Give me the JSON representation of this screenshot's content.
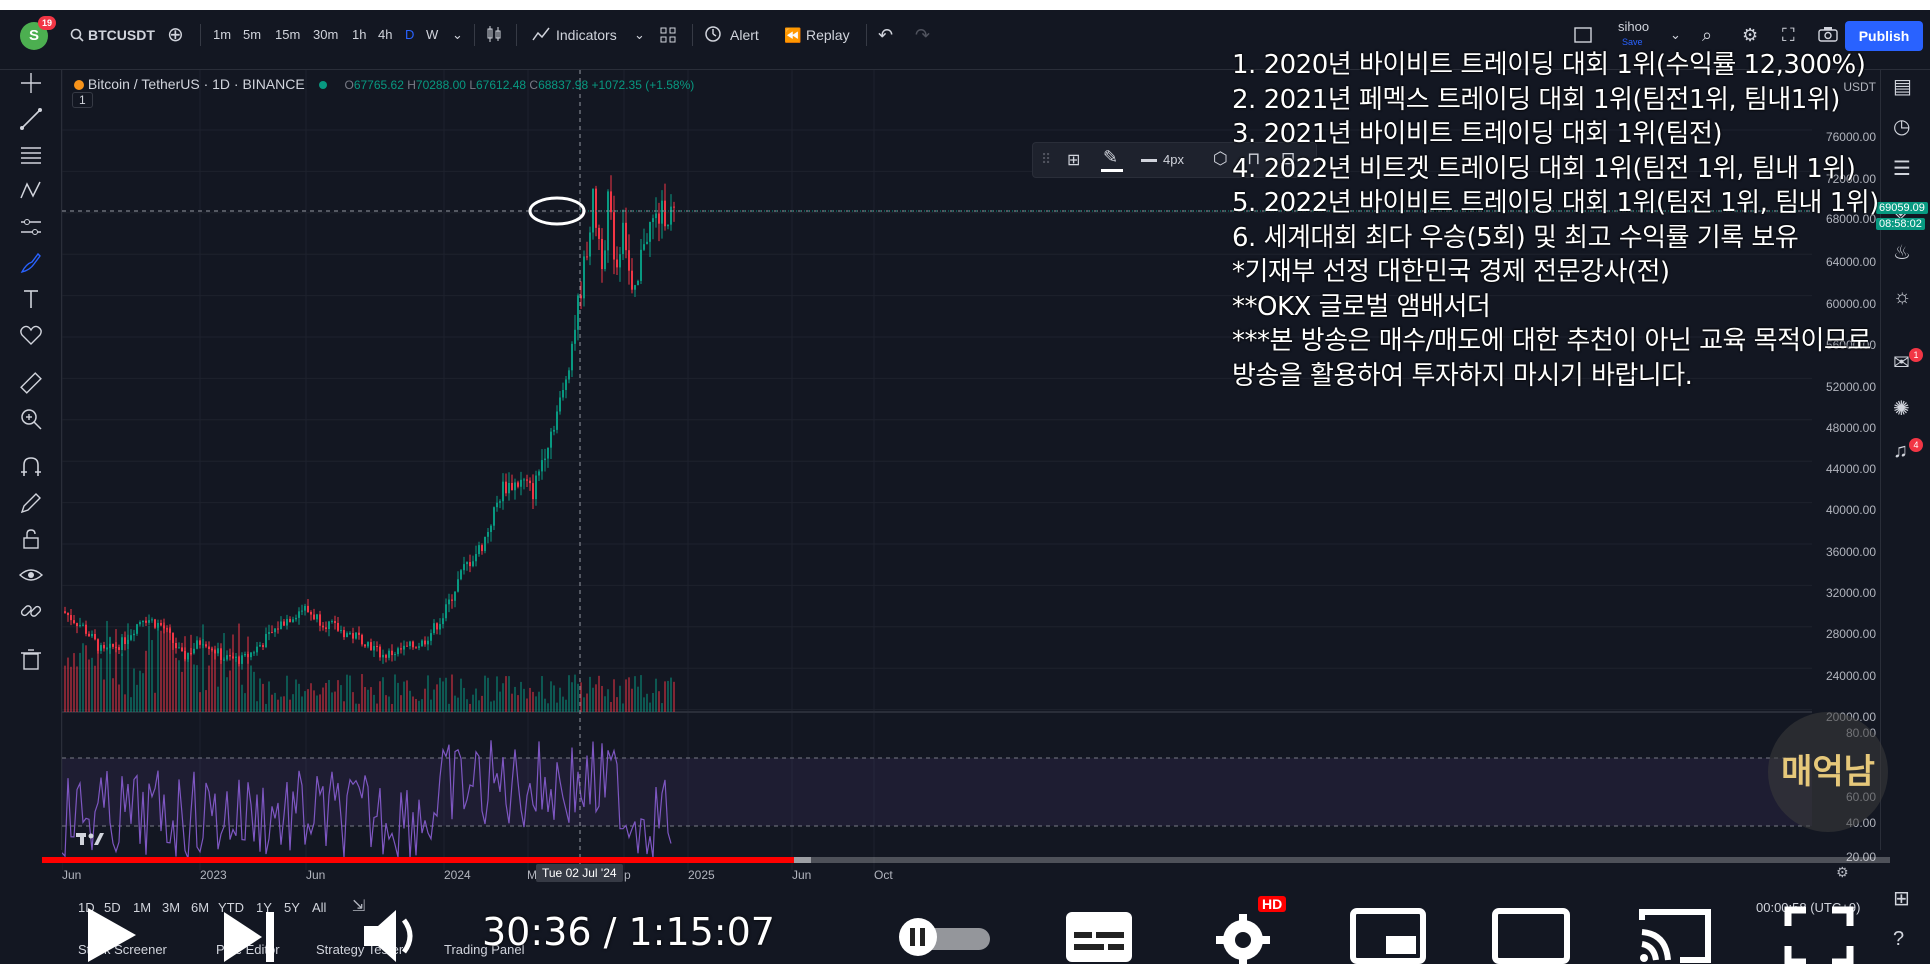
{
  "header": {
    "avatar_letter": "S",
    "avatar_badge": "19",
    "symbol": "BTCUSDT",
    "intervals": [
      "1m",
      "5m",
      "15m",
      "30m",
      "1h",
      "4h",
      "D",
      "W"
    ],
    "active_interval": "D",
    "indicators_label": "Indicators",
    "alert_label": "Alert",
    "replay_label": "Replay",
    "user": "sihoo",
    "user_status": "Save",
    "publish_label": "Publish"
  },
  "legend": {
    "name": "Bitcoin / TetherUS · 1D · BINANCE",
    "open_label": "O",
    "open": "67765.62",
    "high_label": "H",
    "high": "70288.00",
    "low_label": "L",
    "low": "67612.48",
    "close_label": "C",
    "close": "68837.98",
    "change": "+1072.35 (+1.58%)",
    "pane_number": "1"
  },
  "drawbar": {
    "width_label": "4px"
  },
  "price_axis": {
    "ticks": [
      "USDT",
      "76000.00",
      "72000.00",
      "68000.00",
      "64000.00",
      "60000.00",
      "56000.00",
      "52000.00",
      "48000.00",
      "44000.00",
      "40000.00",
      "36000.00",
      "32000.00",
      "28000.00",
      "24000.00",
      "20000.00"
    ],
    "price_tag": "69059.09",
    "countdown_tag": "08:58:02",
    "rsi_ticks": [
      "80.00",
      "60.00",
      "40.00",
      "20.00"
    ]
  },
  "time_axis": {
    "ticks": [
      "Jun",
      "2023",
      "Jun",
      "2024",
      "M",
      "p",
      "2025",
      "Jun",
      "Oct"
    ],
    "crosshair_time": "Tue 02 Jul '24"
  },
  "ranges": [
    "1D",
    "5D",
    "1M",
    "3M",
    "6M",
    "YTD",
    "1Y",
    "5Y",
    "All"
  ],
  "timezone": "00:00:58 (UTC+9)",
  "bottom_tabs": [
    "Stock Screener",
    "Pine Editor",
    "Strategy Tester",
    "Trading Panel"
  ],
  "overlay_text": [
    "1. 2020년 바이비트 트레이딩 대회 1위(수익률 12,300%)",
    "2. 2021년 페멕스 트레이딩 대회 1위(팀전1위, 팀내1위)",
    "3. 2021년 바이비트 트레이딩 대회 1위(팀전)",
    "4. 2022년 비트겟 트레이딩 대회 1위(팀전 1위, 팀내 1위)",
    "5. 2022년 바이비트 트레이딩 대회 1위(팀전 1위, 팀내 1위)",
    "6. 세계대회 최다 우승(5회) 및 최고 수익률 기록 보유",
    "*기재부 선정 대한민국 경제 전문강사(전)",
    "**OKX 글로벌 앰배서더",
    "***본 방송은 매수/매도에 대한 추천이 아닌 교육 목적이므로",
    " 방송을 활용하여 투자하지 마시기 바랍니다."
  ],
  "video": {
    "current_time": "30:36",
    "duration": "1:15:07",
    "time_display": "30:36 / 1:15:07",
    "progress_fraction": 0.407,
    "buffered_fraction": 0.416,
    "hd_badge": "HD",
    "watermark": "매억남"
  },
  "right_badges": {
    "chat": "1",
    "alerts": "4"
  },
  "colors": {
    "up": "#089981",
    "down": "#f23645",
    "rsi": "#7e57c2",
    "accent": "#2962ff",
    "progress": "#ff0000"
  }
}
